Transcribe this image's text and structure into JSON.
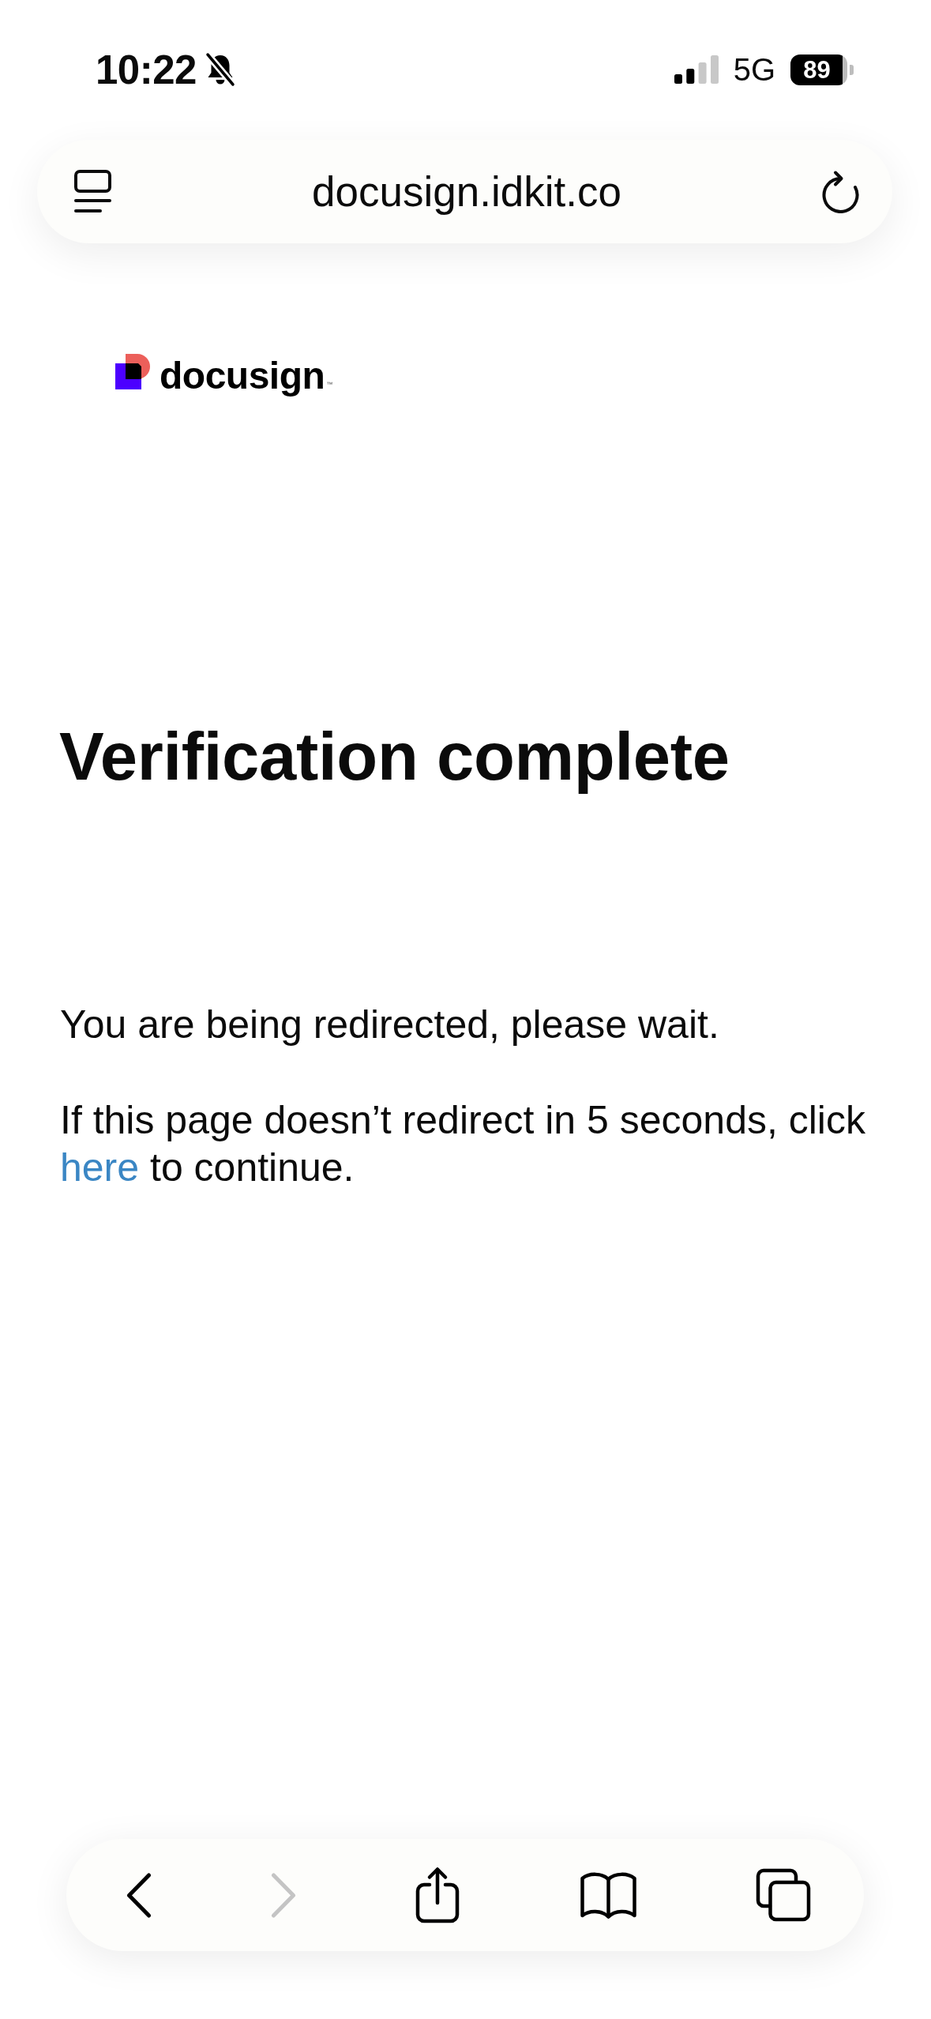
{
  "status_bar": {
    "time": "10:22",
    "silent": true,
    "network": "5G",
    "battery": "89"
  },
  "address_bar": {
    "url": "docusign.idkit.co"
  },
  "logo": {
    "wordmark": "docusign",
    "trademark": "™"
  },
  "heading": "Verification complete",
  "paragraphs": [
    {
      "text": "You are being redirected, please wait."
    },
    {
      "text": "If this page doesn’t redirect in 5 seconds, click",
      "link": "here",
      "after": "to continue."
    }
  ],
  "toolbar": [
    {
      "kind": "back",
      "disabled": false
    },
    {
      "kind": "forward",
      "disabled": true
    },
    {
      "kind": "share",
      "disabled": false
    },
    {
      "kind": "bookmarks",
      "disabled": false
    },
    {
      "kind": "tabs",
      "disabled": false
    }
  ]
}
